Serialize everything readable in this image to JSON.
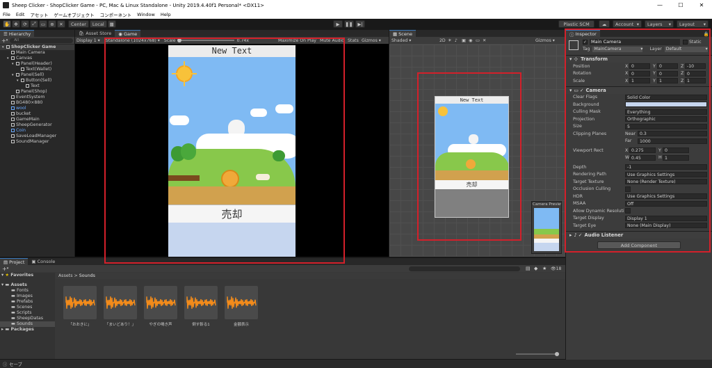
{
  "window": {
    "title": "Sheep Clicker - ShopClicker Game - PC, Mac & Linux Standalone - Unity 2019.4.40f1 Personal* <DX11>"
  },
  "menu": [
    "File",
    "Edit",
    "アセット",
    "ゲームオブジェクト",
    "コンポーネント",
    "Window",
    "Help"
  ],
  "toolbar": {
    "center_label": "Center",
    "local_label": "Local",
    "plastic_label": "Plastic SCM",
    "account_label": "Account",
    "layers_label": "Layers",
    "layout_label": "Layout"
  },
  "hierarchy": {
    "tab": "Hierarchy",
    "search_placeholder": "All",
    "items": [
      {
        "label": "ShopClicker Game",
        "indent": 0,
        "bold": true,
        "blue": false
      },
      {
        "label": "Main Camera",
        "indent": 1,
        "bold": false,
        "blue": false
      },
      {
        "label": "Canvas",
        "indent": 1,
        "bold": false,
        "blue": false
      },
      {
        "label": "Panel(Header)",
        "indent": 2,
        "bold": false,
        "blue": false
      },
      {
        "label": "Text(Wallet)",
        "indent": 3,
        "bold": false,
        "blue": false
      },
      {
        "label": "Panel(Sell)",
        "indent": 2,
        "bold": false,
        "blue": false
      },
      {
        "label": "Button(Sell)",
        "indent": 3,
        "bold": false,
        "blue": false
      },
      {
        "label": "Text",
        "indent": 4,
        "bold": false,
        "blue": false
      },
      {
        "label": "Panel(Shop)",
        "indent": 2,
        "bold": false,
        "blue": false
      },
      {
        "label": "EventSystem",
        "indent": 1,
        "bold": false,
        "blue": false
      },
      {
        "label": "BG480×880",
        "indent": 1,
        "bold": false,
        "blue": false
      },
      {
        "label": "wool",
        "indent": 1,
        "bold": false,
        "blue": true
      },
      {
        "label": "bucket",
        "indent": 1,
        "bold": false,
        "blue": false
      },
      {
        "label": "GameMain",
        "indent": 1,
        "bold": false,
        "blue": false
      },
      {
        "label": "SheepGenerator",
        "indent": 1,
        "bold": false,
        "blue": false
      },
      {
        "label": "Coin",
        "indent": 1,
        "bold": false,
        "blue": true
      },
      {
        "label": "SaveLoadManager",
        "indent": 1,
        "bold": false,
        "blue": false
      },
      {
        "label": "SoundManager",
        "indent": 1,
        "bold": false,
        "blue": false
      }
    ]
  },
  "game": {
    "tab_asset_store": "Asset Store",
    "tab_game": "Game",
    "display": "Display 1",
    "resolution": "Standalone (1024x768)",
    "scale_label": "Scale",
    "scale_value": "0.74x",
    "maximize": "Maximize On Play",
    "mute": "Mute Audio",
    "stats": "Stats",
    "gizmos": "Gizmos",
    "header_text": "New Text",
    "sell_text": "売却"
  },
  "scene": {
    "tab": "Scene",
    "shading": "Shaded",
    "mode_2d": "2D",
    "gizmos": "Gizmos",
    "search_placeholder": "All",
    "header_text": "New Text",
    "sell_text": "売却",
    "camera_preview": "Camera Preview"
  },
  "inspector": {
    "tab": "Inspector",
    "object_name": "Main Camera",
    "static_label": "Static",
    "tag_label": "Tag",
    "tag_value": "MainCamera",
    "layer_label": "Layer",
    "layer_value": "Default",
    "transform": {
      "title": "Transform",
      "position_label": "Position",
      "rotation_label": "Rotation",
      "scale_label": "Scale",
      "position": [
        "0",
        "0",
        "-10"
      ],
      "rotation": [
        "0",
        "0",
        "0"
      ],
      "scale": [
        "1",
        "1",
        "1"
      ]
    },
    "camera": {
      "title": "Camera",
      "rows": [
        {
          "label": "Clear Flags",
          "value": "Solid Color"
        },
        {
          "label": "Background",
          "value": ""
        },
        {
          "label": "Culling Mask",
          "value": "Everything"
        },
        {
          "label": "Projection",
          "value": "Orthographic"
        },
        {
          "label": "Size",
          "value": "5"
        }
      ],
      "clipping_label": "Clipping Planes",
      "near_label": "Near",
      "near_value": "0.3",
      "far_label": "Far",
      "far_value": "1000",
      "viewport_label": "Viewport Rect",
      "viewport": {
        "x": "0.275",
        "y": "0",
        "w": "0.45",
        "h": "1"
      },
      "rows2": [
        {
          "label": "Depth",
          "value": "-1"
        },
        {
          "label": "Rendering Path",
          "value": "Use Graphics Settings"
        },
        {
          "label": "Target Texture",
          "value": "None (Render Texture)"
        },
        {
          "label": "Occlusion Culling",
          "value": ""
        },
        {
          "label": "HDR",
          "value": "Use Graphics Settings"
        },
        {
          "label": "MSAA",
          "value": "Off"
        },
        {
          "label": "Allow Dynamic Resoluti",
          "value": ""
        },
        {
          "label": "Target Display",
          "value": "Display 1"
        },
        {
          "label": "Target Eye",
          "value": "None (Main Display)"
        }
      ]
    },
    "audio_listener": "Audio Listener",
    "add_component": "Add Component"
  },
  "project": {
    "tab_project": "Project",
    "tab_console": "Console",
    "favorites": "Favorites",
    "assets": "Assets",
    "folders": [
      "Fonts",
      "Images",
      "Prefabs",
      "Scenes",
      "Scripts",
      "SheepDatas",
      "Sounds"
    ],
    "packages": "Packages",
    "breadcrumb_root": "Assets",
    "breadcrumb_current": "Sounds",
    "count": "18",
    "files": [
      "「おおきに」",
      "「まいどあり！」",
      "やぎの鳴き声",
      "倒す斬る1",
      "金額表示"
    ]
  },
  "statusbar": {
    "text": "セーブ"
  },
  "colors": {
    "accent_red": "#d4202a",
    "sky": "#6fb3f2",
    "grass": "#7cc84a",
    "coin": "#f0a93a",
    "audio_wave": "#f28b1b"
  }
}
